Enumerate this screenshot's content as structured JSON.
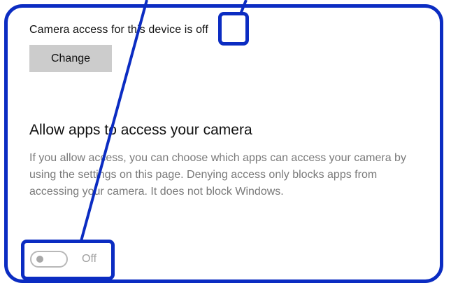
{
  "camera_access": {
    "status_prefix": "Camera access for this device is ",
    "status_value": "off",
    "change_label": "Change"
  },
  "app_access": {
    "title": "Allow apps to access your camera",
    "description": "If you allow access, you can choose which apps can access your camera by using the settings on this page. Denying access only blocks apps from accessing your camera. It does not block Windows.",
    "toggle_state": "Off"
  },
  "colors": {
    "annotation": "#0b2cc2",
    "button_bg": "#cccccc",
    "muted_text": "#7a7a7a"
  }
}
